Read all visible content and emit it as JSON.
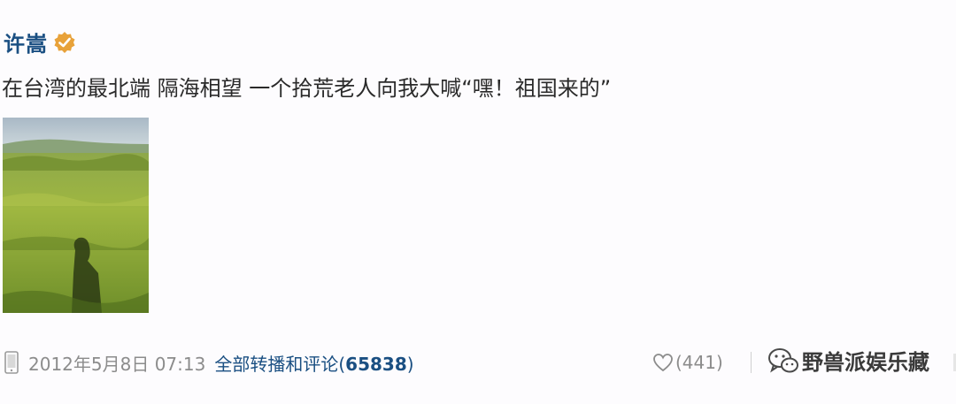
{
  "post": {
    "author": "许嵩",
    "verified_icon": "verified-badge-icon",
    "text": "在台湾的最北端 隔海相望 一个拾荒老人向我大喊“嘿！祖国来的”",
    "image": "photo of grassy field with shadow of photographer",
    "timestamp": "2012年5月8日 07:13",
    "repost_label": "全部转播和评论",
    "repost_count": "65838",
    "like_count": "(441)",
    "watermark_text": "野兽派娱乐藏",
    "colors": {
      "link": "#1a4f82",
      "muted": "#8c8c8c",
      "badge": "#e8a23a"
    }
  }
}
